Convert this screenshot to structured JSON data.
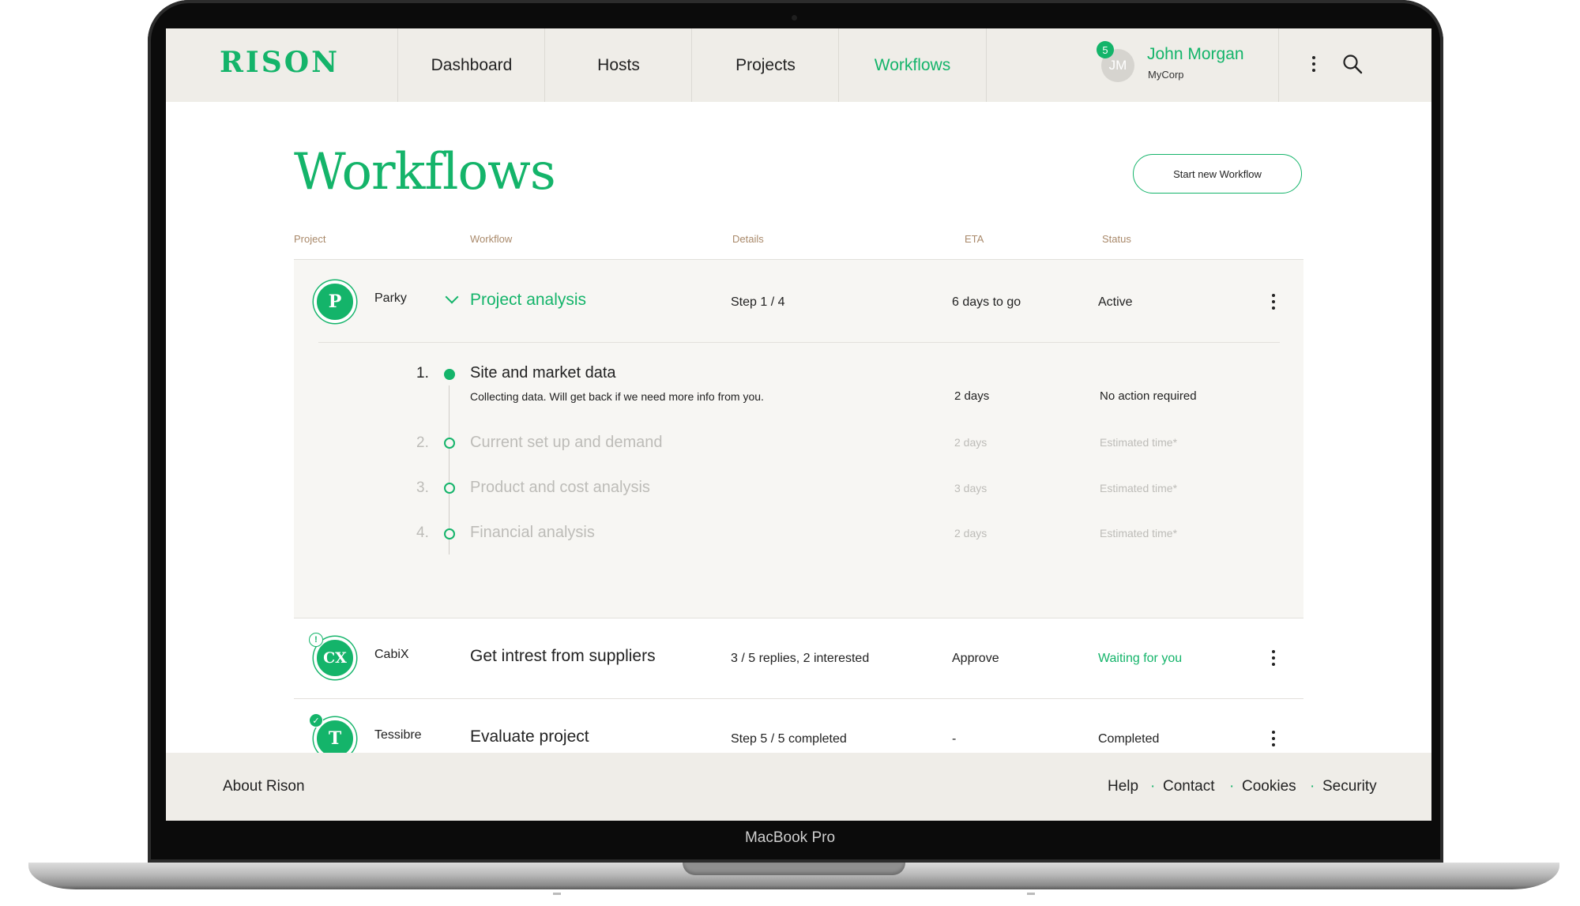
{
  "device": {
    "model_label": "MacBook Pro"
  },
  "header": {
    "logo": "RISON",
    "nav": [
      "Dashboard",
      "Hosts",
      "Projects",
      "Workflows"
    ],
    "active_nav": "Workflows",
    "user": {
      "initials": "JM",
      "name": "John Morgan",
      "company": "MyCorp",
      "notifications": "5"
    }
  },
  "page": {
    "title": "Workflows",
    "new_button": "Start new Workflow",
    "columns": {
      "project": "Project",
      "workflow": "Workflow",
      "details": "Details",
      "eta": "ETA",
      "status": "Status"
    }
  },
  "rows": [
    {
      "initials": "P",
      "project": "Parky",
      "workflow": "Project analysis",
      "details": "Step 1 / 4",
      "eta": "6 days to go",
      "status": "Active",
      "expanded": true,
      "steps": [
        {
          "num": "1.",
          "title": "Site and market data",
          "desc": "Collecting data. Will get back if we need more info from you.",
          "eta": "2 days",
          "status": "No action required",
          "state": "current"
        },
        {
          "num": "2.",
          "title": "Current set up and demand",
          "eta": "2 days",
          "status": "Estimated time*",
          "state": "pending"
        },
        {
          "num": "3.",
          "title": "Product and cost analysis",
          "eta": "3 days",
          "status": "Estimated time*",
          "state": "pending"
        },
        {
          "num": "4.",
          "title": "Financial analysis",
          "eta": "2 days",
          "status": "Estimated time*",
          "state": "pending"
        }
      ]
    },
    {
      "initials": "CX",
      "project": "CabiX",
      "workflow": "Get intrest from suppliers",
      "details": "3 / 5 replies, 2 interested",
      "eta": "Approve",
      "status": "Waiting for you",
      "flag": "!"
    },
    {
      "initials": "T",
      "project": "Tessibre",
      "workflow": "Evaluate project",
      "details": "Step 5 / 5 completed",
      "eta": "-",
      "status": "Completed",
      "flag": "✓"
    }
  ],
  "footer": {
    "about": "About Rison",
    "links": [
      "Help",
      "Contact",
      "Cookies",
      "Security"
    ],
    "separator": "·"
  },
  "colors": {
    "accent": "#14b46a",
    "header_bg": "#efede8",
    "panel_bg": "#f7f6f3",
    "column_header": "#a9896a"
  }
}
